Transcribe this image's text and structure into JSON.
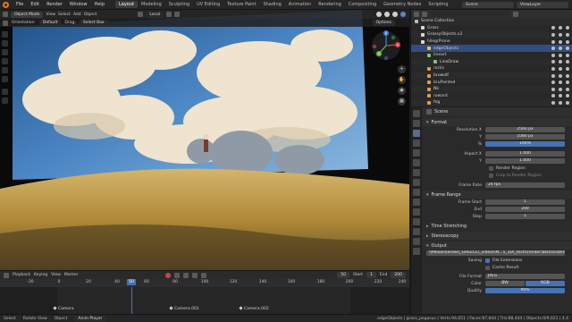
{
  "topbar": {
    "menus": [
      "File",
      "Edit",
      "Render",
      "Window",
      "Help"
    ],
    "workspaces": [
      "Layout",
      "Modeling",
      "Sculpting",
      "UV Editing",
      "Texture Paint",
      "Shading",
      "Animation",
      "Rendering",
      "Compositing",
      "Geometry Nodes",
      "Scripting"
    ],
    "active_workspace": "Layout",
    "scene": "Scene",
    "view_layer": "ViewLayer"
  },
  "viewport": {
    "mode": "Object Mode",
    "menus": [
      "View",
      "Select",
      "Add",
      "Object"
    ],
    "orientation_label": "Orientation:",
    "orientation_value": "Default",
    "drag_label": "Drag:",
    "drag_value": "Select Box",
    "transform_space": "Local",
    "options": "Options",
    "gizmo_axes": [
      "X",
      "Y",
      "Z"
    ]
  },
  "timeline": {
    "menus": [
      "Playback",
      "Keying",
      "View",
      "Marker"
    ],
    "current_frame": "50",
    "frame_field": "50",
    "start_label": "Start",
    "start": "1",
    "end_label": "End",
    "end": "200",
    "ticks": [
      "-20",
      "0",
      "20",
      "40",
      "60",
      "80",
      "100",
      "120",
      "140",
      "160",
      "180",
      "200",
      "220",
      "240"
    ],
    "markers": [
      "Camera",
      "Camera.001",
      "Camera.002"
    ]
  },
  "statusbar": {
    "items": [
      "Select",
      "Rotate View",
      "Object",
      "Anim Player"
    ],
    "info": "edgeObjects | grass_pegasus | Verts:94,651 | Faces:87,844 | Tris:88,444 | Objects:0/9,021 | 4.4"
  },
  "outliner": {
    "collection": "Scene Collection",
    "rows": [
      {
        "name": "Grass",
        "indent": 1,
        "color": "#d8d8d8"
      },
      {
        "name": "GrassyObjects.v2",
        "indent": 1,
        "color": "#d8d8d8"
      },
      {
        "name": "hilegrProne",
        "indent": 1,
        "color": "#d8d8d8"
      },
      {
        "name": "edgeObjects",
        "indent": 2,
        "color": "#f0c05a",
        "selected": true
      },
      {
        "name": "lineart",
        "indent": 2,
        "color": "#7fc27f"
      },
      {
        "name": "LineDraw",
        "indent": 3,
        "color": "#7fc27f"
      },
      {
        "name": "rocks",
        "indent": 2,
        "color": "#e09a4a"
      },
      {
        "name": "bruwolf",
        "indent": 2,
        "color": "#e09a4a"
      },
      {
        "name": "bruPainted",
        "indent": 2,
        "color": "#e09a4a"
      },
      {
        "name": "Nk",
        "indent": 2,
        "color": "#e09a4a"
      },
      {
        "name": "roward",
        "indent": 2,
        "color": "#e09a4a"
      },
      {
        "name": "fog",
        "indent": 2,
        "color": "#e09a4a"
      }
    ]
  },
  "properties": {
    "header": "Scene",
    "format_section": "Format",
    "res_x_label": "Resolution X",
    "res_x": "2560 px",
    "res_y_label": "Y",
    "res_y": "1080 px",
    "res_pct_label": "%",
    "res_pct": "100%",
    "aspect_x_label": "Aspect X",
    "aspect_x": "1.000",
    "aspect_y_label": "Y",
    "aspect_y": "1.000",
    "render_region": "Render Region",
    "crop_region": "Crop to Render Region",
    "frame_rate_label": "Frame Rate",
    "frame_rate": "24 fps",
    "frame_range_section": "Frame Range",
    "frame_start_label": "Frame Start",
    "frame_start": "1",
    "end_label": "End",
    "end": "200",
    "step_label": "Step",
    "step": "1",
    "time_stretching": "Time Stretching",
    "stereoscopy": "Stereoscopy",
    "output_section": "Output",
    "output_path": "\\\\Meow\\heroes\\_GREECE\\_videos\\N...5_3D\\_tests\\render\\bkRock\\bkRock_",
    "saving_label": "Saving",
    "file_extensions": "File Extensions",
    "cache_result": "Cache Result",
    "file_format_label": "File Format",
    "file_format": "JPEG",
    "color_label": "Color",
    "color_options": [
      "BW",
      "RGB"
    ],
    "color_selected": "RGB",
    "quality_label": "Quality",
    "quality": "90%"
  }
}
